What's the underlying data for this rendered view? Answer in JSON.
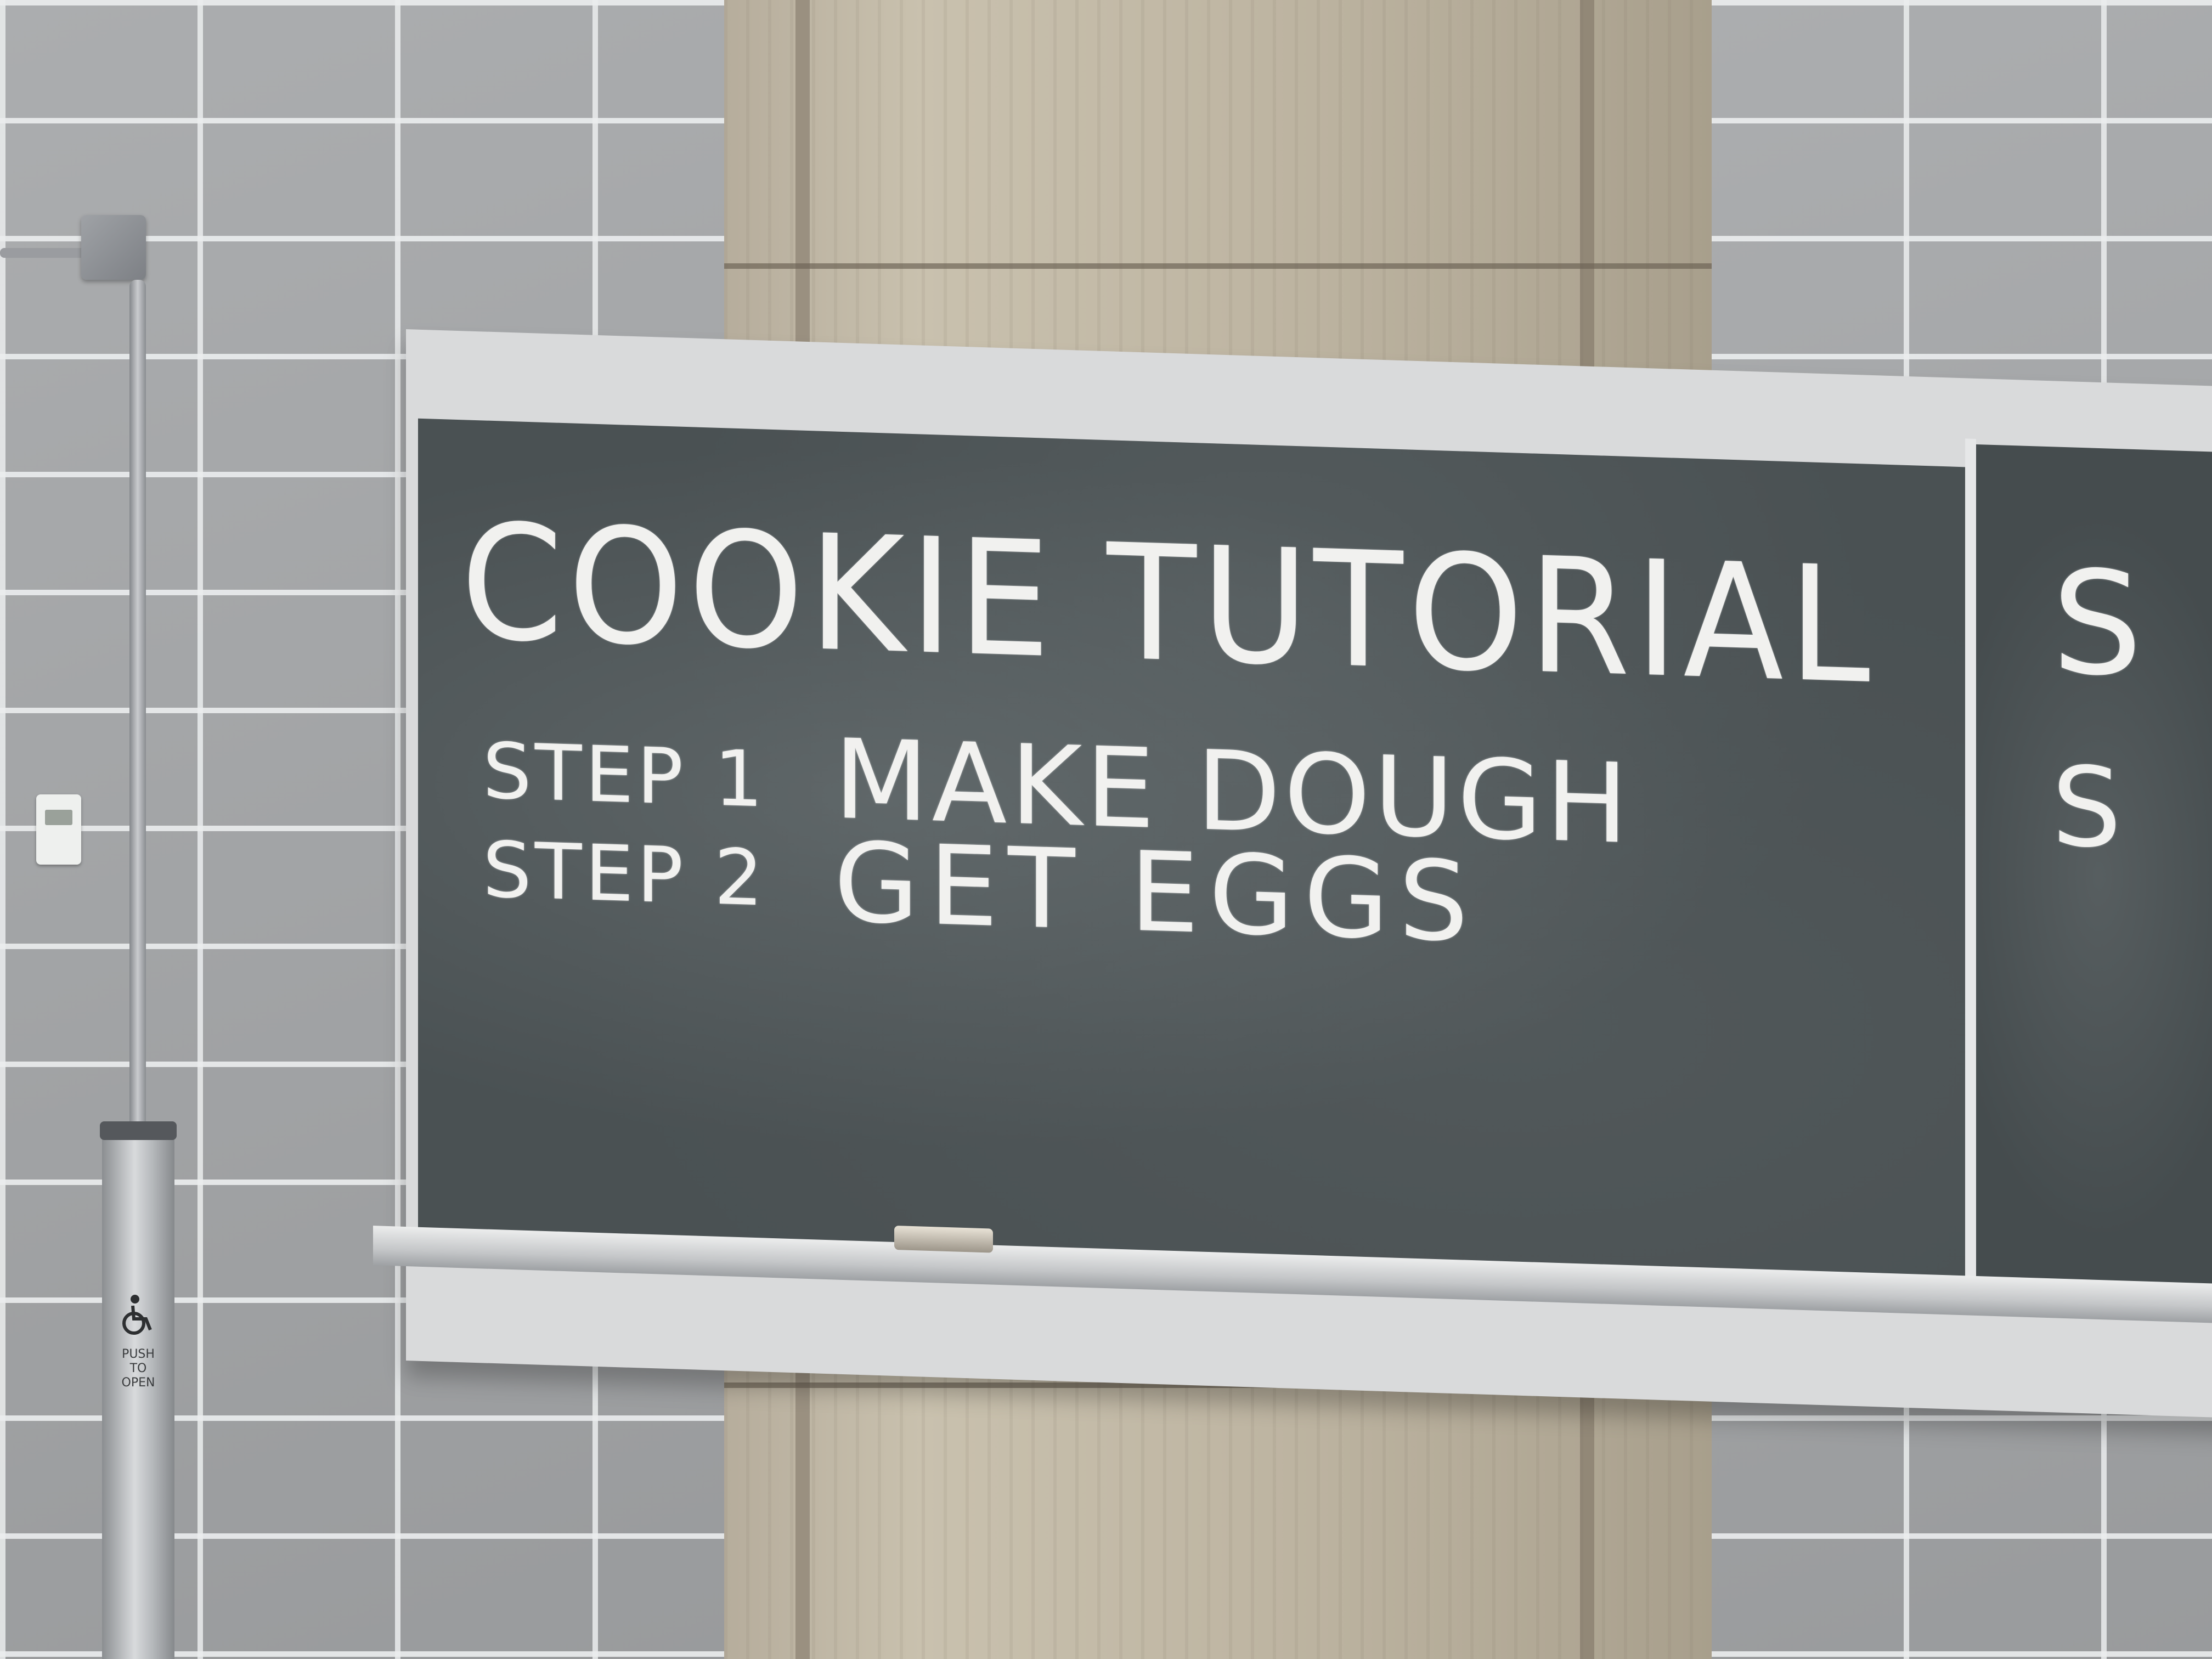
{
  "scene": {
    "chalkboard": {
      "title": "COOKIE TUTORIAL",
      "steps": [
        {
          "label": "STEP 1",
          "text": "MAKE DOUGH"
        },
        {
          "label": "STEP 2",
          "text": "GET EGGS"
        }
      ],
      "right_panel_partial": [
        "S",
        "S"
      ]
    },
    "door_opener": {
      "icon": "wheelchair-icon",
      "label": "PUSH\nTO\nOPEN"
    }
  },
  "colors": {
    "chalkboard": "#4a5153",
    "chalk": "#f1f1ef",
    "wall": "#a6a8aa",
    "concrete": "#c2b9a6"
  }
}
